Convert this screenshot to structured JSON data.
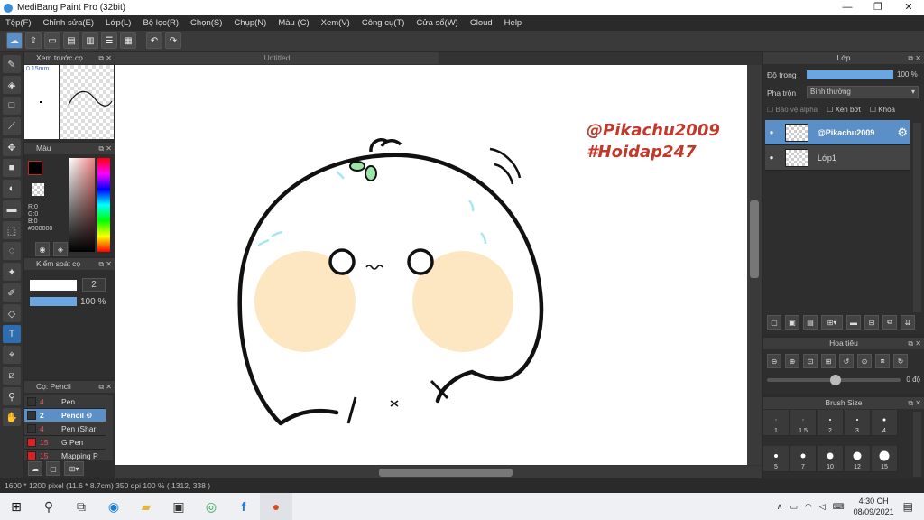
{
  "window": {
    "title": "MediBang Paint Pro (32bit)",
    "min": "—",
    "max": "❐",
    "close": "✕"
  },
  "menu": [
    "Tệp(F)",
    "Chỉnh sửa(E)",
    "Lớp(L)",
    "Bộ lọc(R)",
    "Chọn(S)",
    "Chụp(N)",
    "Màu (C)",
    "Xem(V)",
    "Công cụ(T)",
    "Cửa sổ(W)",
    "Cloud",
    "Help"
  ],
  "preview_panel": {
    "title": "Xem trước cọ",
    "size": "0.15mm"
  },
  "color_panel": {
    "title": "Màu",
    "r": "R:0",
    "g": "G:0",
    "b": "B:0",
    "hex": "#000000",
    "primary_color": "#000000"
  },
  "brush_control": {
    "title": "Kiểm soát cọ",
    "size": "2",
    "opacity": "100 %"
  },
  "brush_list": {
    "title": "Cọ: Pencil",
    "items": [
      {
        "size": "4",
        "name": "Pen",
        "color": "#333333"
      },
      {
        "size": "2",
        "name": "Pencil",
        "color": "#333333"
      },
      {
        "size": "4",
        "name": "Pen (Shar",
        "color": "#333333"
      },
      {
        "size": "15",
        "name": "G Pen",
        "color": "#e02020"
      },
      {
        "size": "15",
        "name": "Mapping P",
        "color": "#e02020"
      }
    ]
  },
  "canvas": {
    "tab": "Untitled",
    "watermark_1": "@Pikachu2009",
    "watermark_2": "#Hoidap247"
  },
  "layer_panel": {
    "title": "Lớp",
    "opacity_label": "Độ trong",
    "opacity_value": "100 %",
    "blend_label": "Pha trộn",
    "blend_value": "Bình thường",
    "protect_alpha": "Bảo vệ alpha",
    "clipping": "Xén bớt",
    "lock": "Khóa",
    "layers": [
      {
        "name": "@Pikachu2009"
      },
      {
        "name": "Lớp1"
      }
    ]
  },
  "navigator": {
    "title": "Hoa tiêu",
    "angle": "0 độ"
  },
  "brush_size": {
    "title": "Brush Size",
    "sizes": [
      "1",
      "1.5",
      "2",
      "3",
      "4",
      "5",
      "7",
      "10",
      "12",
      "15"
    ]
  },
  "status": {
    "text": "1600 * 1200 pixel   (11.6 * 8.7cm)   350 dpi   100 %   ( 1312, 338 )"
  },
  "taskbar": {
    "time": "4:30 CH",
    "date": "08/09/2021"
  }
}
